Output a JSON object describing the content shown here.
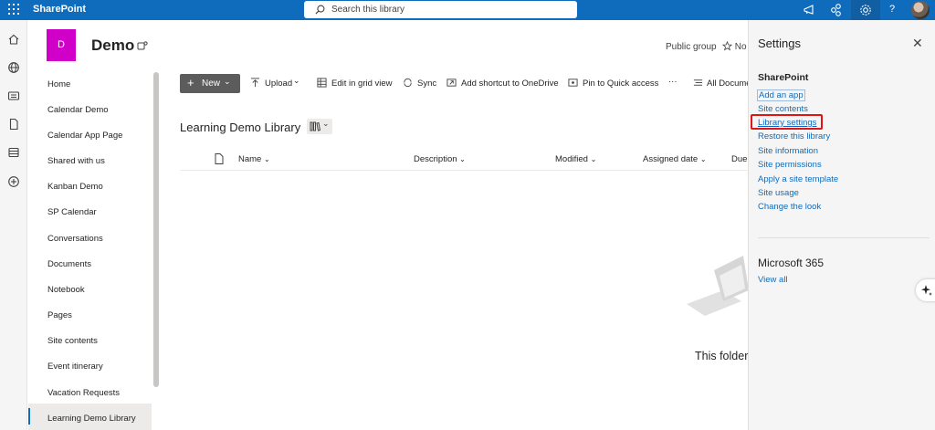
{
  "topbar": {
    "app_name": "SharePoint",
    "search_placeholder": "Search this library",
    "color": "#0f6cbd"
  },
  "site": {
    "logo_letter": "D",
    "logo_color": "#d100c9",
    "title": "Demo",
    "privacy": "Public group",
    "follow_label": "No"
  },
  "nav": {
    "items": [
      "Home",
      "Calendar Demo",
      "Calendar App Page",
      "Shared with us",
      "Kanban Demo",
      "SP Calendar",
      "Conversations",
      "Documents",
      "Notebook",
      "Pages",
      "Site contents",
      "Event itinerary",
      "Vacation Requests",
      "Learning Demo Library"
    ],
    "active": "Learning Demo Library"
  },
  "commandbar": {
    "new_label": "New",
    "upload_label": "Upload",
    "grid_label": "Edit in grid view",
    "sync_label": "Sync",
    "shortcut_label": "Add shortcut to OneDrive",
    "pin_label": "Pin to Quick access",
    "more_label": "···",
    "view_label": "All Docume"
  },
  "library": {
    "title": "Learning Demo Library",
    "columns": [
      "Name",
      "Description",
      "Modified",
      "Assigned date",
      "Due"
    ],
    "empty_text": "This folder"
  },
  "settings_panel": {
    "title": "Settings",
    "section1": "SharePoint",
    "links": [
      "Add an app",
      "Site contents",
      "Library settings",
      "Restore this library",
      "Site information",
      "Site permissions",
      "Apply a site template",
      "Site usage",
      "Change the look"
    ],
    "highlighted": "Library settings",
    "section2": "Microsoft 365",
    "view_all": "View all"
  },
  "colors": {
    "accent": "#0f6cbd",
    "highlight": "#e01515"
  }
}
